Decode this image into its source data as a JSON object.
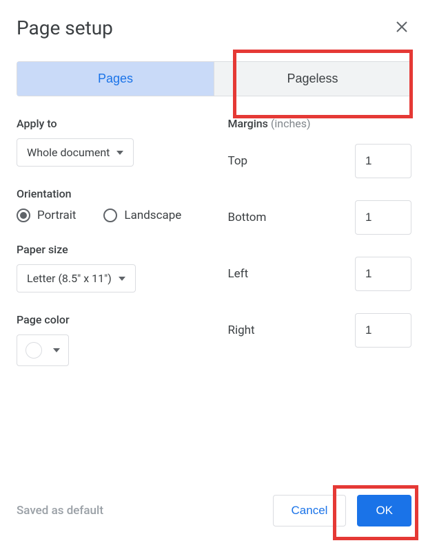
{
  "header": {
    "title": "Page setup"
  },
  "tabs": {
    "pages": "Pages",
    "pageless": "Pageless"
  },
  "apply_to": {
    "label": "Apply to",
    "selected": "Whole document"
  },
  "orientation": {
    "label": "Orientation",
    "portrait": "Portrait",
    "landscape": "Landscape"
  },
  "paper_size": {
    "label": "Paper size",
    "selected": "Letter (8.5\" x 11\")"
  },
  "page_color": {
    "label": "Page color"
  },
  "margins": {
    "label": "Margins",
    "unit": "(inches)",
    "top_label": "Top",
    "bottom_label": "Bottom",
    "left_label": "Left",
    "right_label": "Right",
    "top": "1",
    "bottom": "1",
    "left": "1",
    "right": "1"
  },
  "footer": {
    "saved_default": "Saved as default",
    "cancel": "Cancel",
    "ok": "OK"
  }
}
